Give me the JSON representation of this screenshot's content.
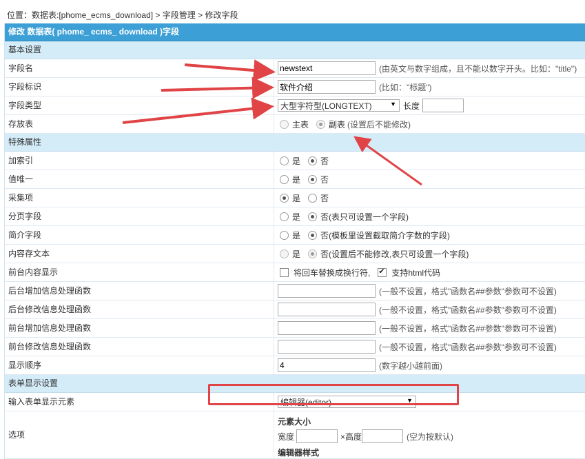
{
  "breadcrumb": {
    "prefix": "位置：数据表:[phome_ecms_download]",
    "sep1": " > ",
    "field_mgmt": "字段管理",
    "sep2": " > ",
    "current": "修改字段"
  },
  "header_title": "修改 数据表( phome_ ecms_ download )字段",
  "sections": {
    "basic": "基本设置",
    "special": "特殊属性",
    "form": "表单显示设置"
  },
  "fields": {
    "name": {
      "label": "字段名",
      "value": "newstext",
      "hint": "(由英文与数字组成，且不能以数字开头。比如：\"title\")"
    },
    "ident": {
      "label": "字段标识",
      "value": "软件介绍",
      "hint": "(比如：\"标题\")"
    },
    "type": {
      "label": "字段类型",
      "value": "大型字符型(LONGTEXT)",
      "len_label": "长度"
    },
    "store": {
      "label": "存放表",
      "opt1": "主表",
      "opt2": "副表",
      "hint": "(设置后不能修改)"
    },
    "index": {
      "label": "加索引",
      "yes": "是",
      "no": "否"
    },
    "unique": {
      "label": "值唯一",
      "yes": "是",
      "no": "否"
    },
    "collect": {
      "label": "采集项",
      "yes": "是",
      "no": "否"
    },
    "page": {
      "label": "分页字段",
      "yes": "是",
      "no": "否(表只可设置一个字段)"
    },
    "intro": {
      "label": "简介字段",
      "yes": "是",
      "no": "否(模板里设置截取简介字数的字段)"
    },
    "savetxt": {
      "label": "内容存文本",
      "yes": "是",
      "no": "否(设置后不能修改,表只可设置一个字段)"
    },
    "frontshow": {
      "label": "前台内容显示",
      "opt1": "将回车替换成换行符,",
      "opt2": "支持html代码"
    },
    "admin_add": {
      "label": "后台增加信息处理函数",
      "hint": "(一般不设置，格式\"函数名##参数\"参数可不设置)"
    },
    "admin_edit": {
      "label": "后台修改信息处理函数",
      "hint": "(一般不设置，格式\"函数名##参数\"参数可不设置)"
    },
    "front_add": {
      "label": "前台增加信息处理函数",
      "hint": "(一般不设置，格式\"函数名##参数\"参数可不设置)"
    },
    "front_edit": {
      "label": "前台修改信息处理函数",
      "hint": "(一般不设置，格式\"函数名##参数\"参数可不设置)"
    },
    "order": {
      "label": "显示顺序",
      "value": "4",
      "hint": "(数字越小越前面)"
    },
    "element": {
      "label": "输入表单显示元素",
      "value": "编辑器(editor)"
    },
    "options": {
      "label": "选项",
      "size_title": "元素大小",
      "width_label": "宽度",
      "height_label": "×高度",
      "size_hint": "(空为按默认)",
      "editor_style": "编辑器样式"
    }
  },
  "colors": {
    "header": "#3c9fd6",
    "section": "#d4ecf8",
    "annotation": "#e04446"
  }
}
